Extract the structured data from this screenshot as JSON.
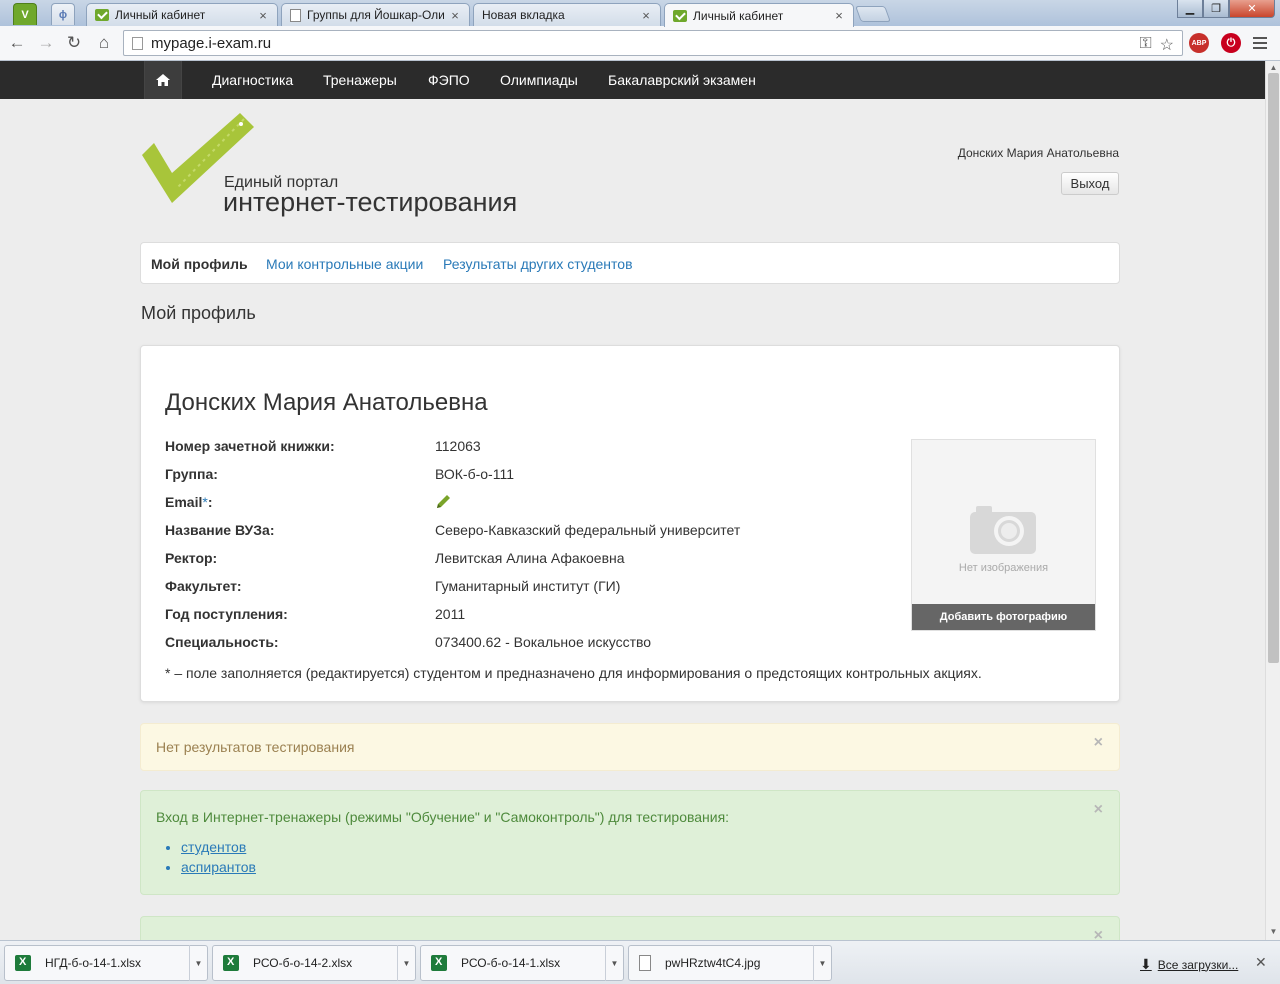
{
  "browser": {
    "tabs": [
      {
        "label": "Личный кабинет"
      },
      {
        "label": "Группы для Йошкар-Оли"
      },
      {
        "label": "Новая вкладка"
      },
      {
        "label": "Личный кабинет"
      }
    ],
    "address": "mypage.i-exam.ru"
  },
  "topnav": {
    "items": [
      "Диагностика",
      "Тренажеры",
      "ФЭПО",
      "Олимпиады",
      "Бакалаврский экзамен"
    ]
  },
  "logo": {
    "line1": "Единый портал",
    "line2": "интернет-тестирования"
  },
  "header": {
    "user_name": "Донских Мария Анатольевна",
    "logout_label": "Выход"
  },
  "subnav": {
    "items": [
      "Мой профиль",
      "Мои контрольные акции",
      "Результаты других студентов"
    ]
  },
  "page_title": "Мой профиль",
  "profile": {
    "full_name": "Донских Мария Анатольевна",
    "rows": [
      {
        "label": "Номер зачетной книжки:",
        "value": "112063"
      },
      {
        "label": "Группа:",
        "value": "ВОК-б-о-111"
      },
      {
        "label": "Email",
        "req": "*",
        "colon": ":",
        "value": ""
      },
      {
        "label": "Название ВУЗа:",
        "value": "Северо-Кавказский федеральный университет"
      },
      {
        "label": "Ректор:",
        "value": "Левитская Алина Афакоевна"
      },
      {
        "label": "Факультет:",
        "value": "Гуманитарный институт (ГИ)"
      },
      {
        "label": "Год поступления:",
        "value": "2011"
      },
      {
        "label": "Специальность:",
        "value": "073400.62 - Вокальное искусство"
      }
    ],
    "footnote": "* – поле заполняется (редактируется) студентом и предназначено для информирования о предстоящих контрольных акциях.",
    "photo": {
      "no_image": "Нет изображения",
      "add_label": "Добавить фотографию"
    }
  },
  "alerts": {
    "no_results": "Нет результатов тестирования",
    "trainers": {
      "text": "Вход в Интернет-тренажеры (режимы \"Обучение\" и \"Самоконтроль\") для тестирования:",
      "links": [
        "студентов",
        "аспирантов"
      ]
    },
    "close_glyph": "×"
  },
  "downloads": {
    "items": [
      "НГД-б-о-14-1.xlsx",
      "РСО-б-о-14-2.xlsx",
      "РСО-б-о-14-1.xlsx",
      "pwHRztw4tC4.jpg"
    ],
    "all_label": "Все загрузки..."
  }
}
